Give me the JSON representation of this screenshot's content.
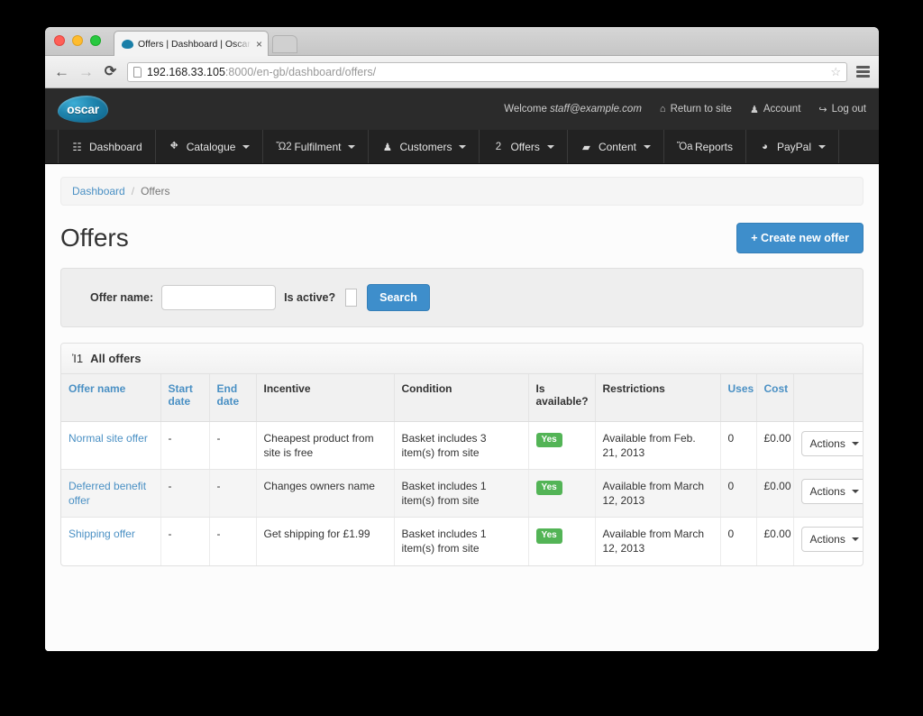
{
  "browser": {
    "tab_title": "Offers | Dashboard | Oscar",
    "tab_close": "×",
    "back_icon": "←",
    "forward_icon": "→",
    "reload_icon": "⟳",
    "url_host": "192.168.33.105",
    "url_rest": ":8000/en-gb/dashboard/offers/",
    "bookmark_icon": "☆"
  },
  "header": {
    "logo_text": "oscar",
    "welcome_prefix": "Welcome ",
    "welcome_user": "staff@example.com",
    "utility": [
      {
        "icon": "⌂",
        "label": "Return to site"
      },
      {
        "icon": "♟",
        "label": "Account"
      },
      {
        "icon": "↪",
        "label": "Log out"
      }
    ]
  },
  "main_nav": [
    {
      "icon": "☷",
      "label": "Dashboard",
      "caret": false
    },
    {
      "icon": "⛖",
      "label": "Catalogue",
      "caret": true
    },
    {
      "icon": "Ὥ2",
      "label": "Fulfilment",
      "caret": true
    },
    {
      "icon": "♟",
      "label": "Customers",
      "caret": true
    },
    {
      "icon": "὎2",
      "label": "Offers",
      "caret": true
    },
    {
      "icon": "▰",
      "label": "Content",
      "caret": true
    },
    {
      "icon": "Ὄa",
      "label": "Reports",
      "caret": false
    },
    {
      "icon": "◕",
      "label": "PayPal",
      "caret": true
    }
  ],
  "breadcrumb": {
    "home": "Dashboard",
    "separator": "/",
    "current": "Offers"
  },
  "page": {
    "title": "Offers",
    "create_button": "+ Create new offer"
  },
  "search": {
    "offer_name_label": "Offer name:",
    "offer_name_value": "",
    "offer_name_placeholder": "",
    "is_active_label": "Is active?",
    "search_button": "Search"
  },
  "table_panel": {
    "icon": "Ἰ1",
    "title": "All offers",
    "columns": [
      {
        "label": "Offer name",
        "sortable": true
      },
      {
        "label": "Start date",
        "sortable": true
      },
      {
        "label": "End date",
        "sortable": true
      },
      {
        "label": "Incentive",
        "sortable": false
      },
      {
        "label": "Condition",
        "sortable": false
      },
      {
        "label": "Is available?",
        "sortable": false
      },
      {
        "label": "Restrictions",
        "sortable": false
      },
      {
        "label": "Uses",
        "sortable": true
      },
      {
        "label": "Cost",
        "sortable": true
      },
      {
        "label": "",
        "sortable": false
      }
    ],
    "rows": [
      {
        "name": "Normal site offer",
        "start_date": "-",
        "end_date": "-",
        "incentive": "Cheapest product from site is free",
        "condition": "Basket includes 3 item(s) from site",
        "is_available": "Yes",
        "restrictions": "Available from Feb. 21, 2013",
        "uses": "0",
        "cost": "£0.00",
        "actions": "Actions"
      },
      {
        "name": "Deferred benefit offer",
        "start_date": "-",
        "end_date": "-",
        "incentive": "Changes owners name",
        "condition": "Basket includes 1 item(s) from site",
        "is_available": "Yes",
        "restrictions": "Available from March 12, 2013",
        "uses": "0",
        "cost": "£0.00",
        "actions": "Actions"
      },
      {
        "name": "Shipping offer",
        "start_date": "-",
        "end_date": "-",
        "incentive": "Get shipping for £1.99",
        "condition": "Basket includes 1 item(s) from site",
        "is_available": "Yes",
        "restrictions": "Available from March 12, 2013",
        "uses": "0",
        "cost": "£0.00",
        "actions": "Actions"
      }
    ]
  },
  "colors": {
    "accent_blue": "#3e8ecb",
    "link_blue": "#4a90c4",
    "badge_green": "#53b456",
    "header_dark": "#2b2b2b",
    "nav_dark": "#222222"
  }
}
